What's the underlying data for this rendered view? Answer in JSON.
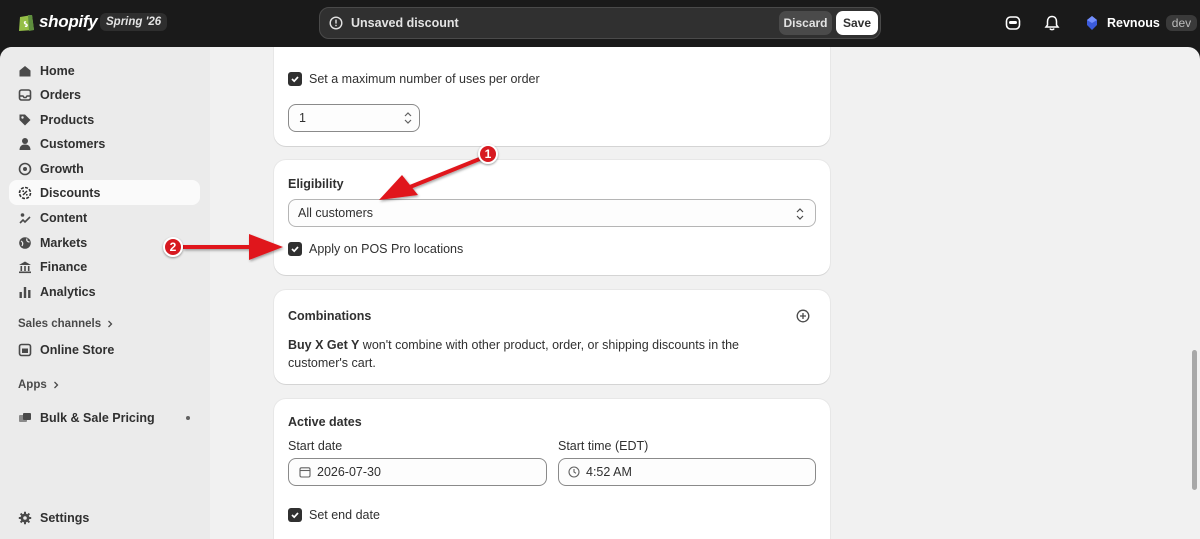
{
  "topbar": {
    "logo_text": "shopify",
    "release_badge": "Spring '26",
    "unsaved_message": "Unsaved discount",
    "discard_label": "Discard",
    "save_label": "Save",
    "user_name": "Revnous",
    "user_tag": "dev"
  },
  "sidebar": {
    "items": [
      {
        "label": "Home",
        "icon": "home-icon"
      },
      {
        "label": "Orders",
        "icon": "inbox-icon"
      },
      {
        "label": "Products",
        "icon": "tag-icon"
      },
      {
        "label": "Customers",
        "icon": "person-icon"
      },
      {
        "label": "Growth",
        "icon": "growth-icon"
      },
      {
        "label": "Discounts",
        "icon": "discount-icon"
      },
      {
        "label": "Content",
        "icon": "content-icon"
      },
      {
        "label": "Markets",
        "icon": "globe-icon"
      },
      {
        "label": "Finance",
        "icon": "bank-icon"
      },
      {
        "label": "Analytics",
        "icon": "chart-icon"
      }
    ],
    "sales_channels_label": "Sales channels",
    "online_store_label": "Online Store",
    "apps_label": "Apps",
    "bulk_sale_label": "Bulk & Sale Pricing",
    "settings_label": "Settings"
  },
  "uses_card": {
    "max_uses_label": "Set a maximum number of uses per order",
    "max_uses_value": "1"
  },
  "eligibility": {
    "title": "Eligibility",
    "selected": "All customers",
    "pos_label": "Apply on POS Pro locations"
  },
  "combinations": {
    "title": "Combinations",
    "bold_prefix": "Buy X Get Y",
    "description": " won't combine with other product, order, or shipping discounts in the customer's cart."
  },
  "active_dates": {
    "title": "Active dates",
    "start_date_label": "Start date",
    "start_date_value": "2026-07-30",
    "start_time_label": "Start time (EDT)",
    "start_time_value": "4:52 AM",
    "end_date_label": "Set end date"
  },
  "annotations": {
    "step1": "1",
    "step2": "2",
    "arrow_color": "#e0151c"
  }
}
